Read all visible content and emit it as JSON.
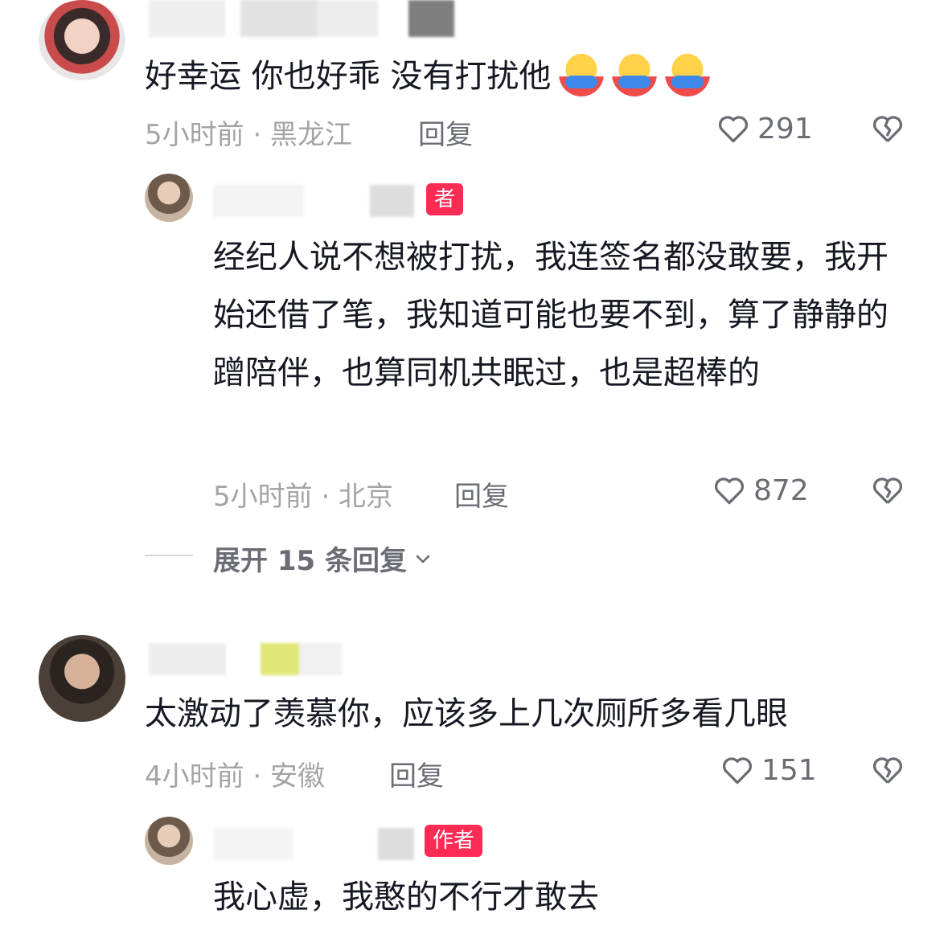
{
  "comments": [
    {
      "text": "好幸运 你也好乖 没有打扰他",
      "emoji_icon": "hugging-face-emoji",
      "meta": "5小时前 · 黑龙江",
      "reply_label": "回复",
      "likes": "291",
      "reply": {
        "author_badge": "者",
        "text": "经纪人说不想被打扰，我连签名都没敢要，我开始还借了笔，我知道可能也要不到，算了静静的蹭陪伴，也算同机共眠过，也是超棒的",
        "meta": "5小时前 · 北京",
        "reply_label": "回复",
        "likes": "872"
      },
      "expand_label": "展开 15 条回复"
    },
    {
      "text": "太激动了羡慕你，应该多上几次厕所多看几眼",
      "meta": "4小时前 · 安徽",
      "reply_label": "回复",
      "likes": "151",
      "reply": {
        "author_badge": "作者",
        "text": "我心虚，我憨的不行才敢去"
      }
    }
  ],
  "icons": {
    "like": "heart-outline-icon",
    "dislike": "broken-heart-icon",
    "expand": "chevron-down-icon"
  },
  "colors": {
    "author_badge": "#fe2c55",
    "meta_text": "#a3a4a8",
    "action_text": "#6b6d75"
  }
}
